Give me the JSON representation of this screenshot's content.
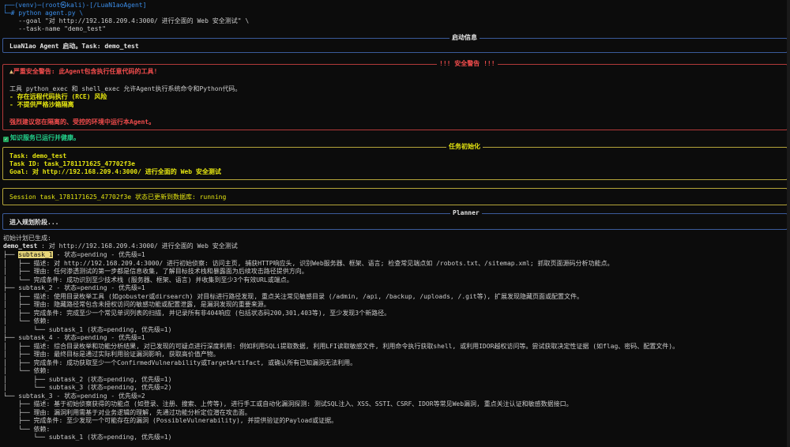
{
  "prompt": {
    "line1": "┌──(venv)─(root㉿kali)-[/LuaN1aoAgent]",
    "line2": "└─# python agent.py \\",
    "line3": "    --goal \"对 http://192.168.209.4:3000/ 进行全面的 Web 安全测试\" \\",
    "line4": "    --task-name \"demo_test\""
  },
  "startup": {
    "title": "启动信息",
    "text": "LuaN1ao Agent 启动。Task: demo_test"
  },
  "security": {
    "title": "!!! 安全警告 !!!",
    "warn_icon": "warning-icon",
    "l1": "严重安全警告: 此Agent包含执行任意代码的工具!",
    "l2": "工具 python_exec 和 shell_exec 允许Agent执行系统命令和Python代码。",
    "l3": "- 存在远程代码执行 (RCE) 风险",
    "l4": "- 不提供严格沙箱隔离",
    "l5": "强烈建议您在隔离的、受控的环境中运行本Agent。"
  },
  "knowledge": {
    "text": "知识服务已运行并健康。"
  },
  "task_init": {
    "title": "任务初始化",
    "task": "Task: demo_test",
    "task_id": "Task ID: task_1781171625_47702f3e",
    "goal": "Goal: 对 http://192.168.209.4:3000/ 进行全面的 Web 安全测试"
  },
  "session": {
    "text": "Session task_1781171625_47702f3e 状态已更新到数据库: running"
  },
  "planner": {
    "title": "Planner",
    "text": "进入规划阶段..."
  },
  "plan": {
    "generated": "初始计划已生成:",
    "root_name": "demo_test",
    "root_rest": " : 对 http://192.168.209.4:3000/ 进行全面的 Web 安全测试",
    "lines": [
      {
        "prefix": "├── ",
        "hl": "subtask_1",
        "text": " - 状态=pending - 优先级=1"
      },
      {
        "prefix": "│   ├── ",
        "text": "描述: 对 http://192.168.209.4:3000/ 进行初始侦察: 访问主页, 捕获HTTP响应头, 识别Web服务器、框架、语言; 检查常见端点如 /robots.txt、/sitemap.xml; 抓取页面源码分析功能点。"
      },
      {
        "prefix": "│   ├── ",
        "text": "理由: 任何渗透测试的第一步都是信息收集, 了解目标技术栈和暴露面为后续攻击路径提供方向。"
      },
      {
        "prefix": "│   └── ",
        "text": "完成条件: 成功识别至少技术栈 (服务器、框架、语言) 并收集到至少3个有效URL或端点。"
      },
      {
        "prefix": "├── ",
        "text": "subtask_2 - 状态=pending - 优先级=1"
      },
      {
        "prefix": "│   ├── ",
        "text": "描述: 使用目录枚举工具 (如gobuster或dirsearch) 对目标进行路径发现, 重点关注常见敏感目录 (/admin, /api, /backup, /uploads, /.git等), 扩展发现隐藏页面或配置文件。"
      },
      {
        "prefix": "│   ├── ",
        "text": "理由: 隐藏路径常包含未授权访问的敏感功能或配置泄露, 是漏洞发现的重要来源。"
      },
      {
        "prefix": "│   ├── ",
        "text": "完成条件: 完成至少一个常见单词列表的扫描, 并记录所有非404响应 (包括状态码200,301,403等), 至少发现3个新路径。"
      },
      {
        "prefix": "│   └── ",
        "text": "依赖:"
      },
      {
        "prefix": "│       └── ",
        "text": "subtask_1 (状态=pending, 优先级=1)"
      },
      {
        "prefix": "├── ",
        "text": "subtask_4 - 状态=pending - 优先级=1"
      },
      {
        "prefix": "│   ├── ",
        "text": "描述: 综合目录枚举和功能分析结果, 对已发现的可疑点进行深度利用: 例如利用SQLi提取数据, 利用LFI读取敏感文件, 利用命令执行获取shell, 或利用IDOR越权访问等。尝试获取决定性证据 (如flag、密码、配置文件)。"
      },
      {
        "prefix": "│   ├── ",
        "text": "理由: 最终目标是通过实际利用验证漏洞影响, 获取高价值产物。"
      },
      {
        "prefix": "│   ├── ",
        "text": "完成条件: 成功获取至少一个ConfirmedVulnerability或TargetArtifact, 或确认所有已知漏洞无法利用。"
      },
      {
        "prefix": "│   └── ",
        "text": "依赖:"
      },
      {
        "prefix": "│       ├── ",
        "text": "subtask_2 (状态=pending, 优先级=1)"
      },
      {
        "prefix": "│       └── ",
        "text": "subtask_3 (状态=pending, 优先级=2)"
      },
      {
        "prefix": "└── ",
        "text": "subtask_3 - 状态=pending - 优先级=2"
      },
      {
        "prefix": "    ├── ",
        "text": "描述: 基于初始侦察获得的功能点 (如登录、注册、搜索、上传等), 进行手工或自动化漏洞探测: 测试SQL注入、XSS、SSTI、CSRF、IDOR等常见Web漏洞, 重点关注认证和敏感数据接口。"
      },
      {
        "prefix": "    ├── ",
        "text": "理由: 漏洞利用需基于对业务逻辑的理解, 先通过功能分析定位潜在攻击面。"
      },
      {
        "prefix": "    ├── ",
        "text": "完成条件: 至少发现一个可能存在的漏洞 (PossibleVulnerability), 并提供验证的Payload或证据。"
      },
      {
        "prefix": "    └── ",
        "text": "依赖:"
      },
      {
        "prefix": "        └── ",
        "text": "subtask_1 (状态=pending, 优先级=1)"
      }
    ]
  }
}
